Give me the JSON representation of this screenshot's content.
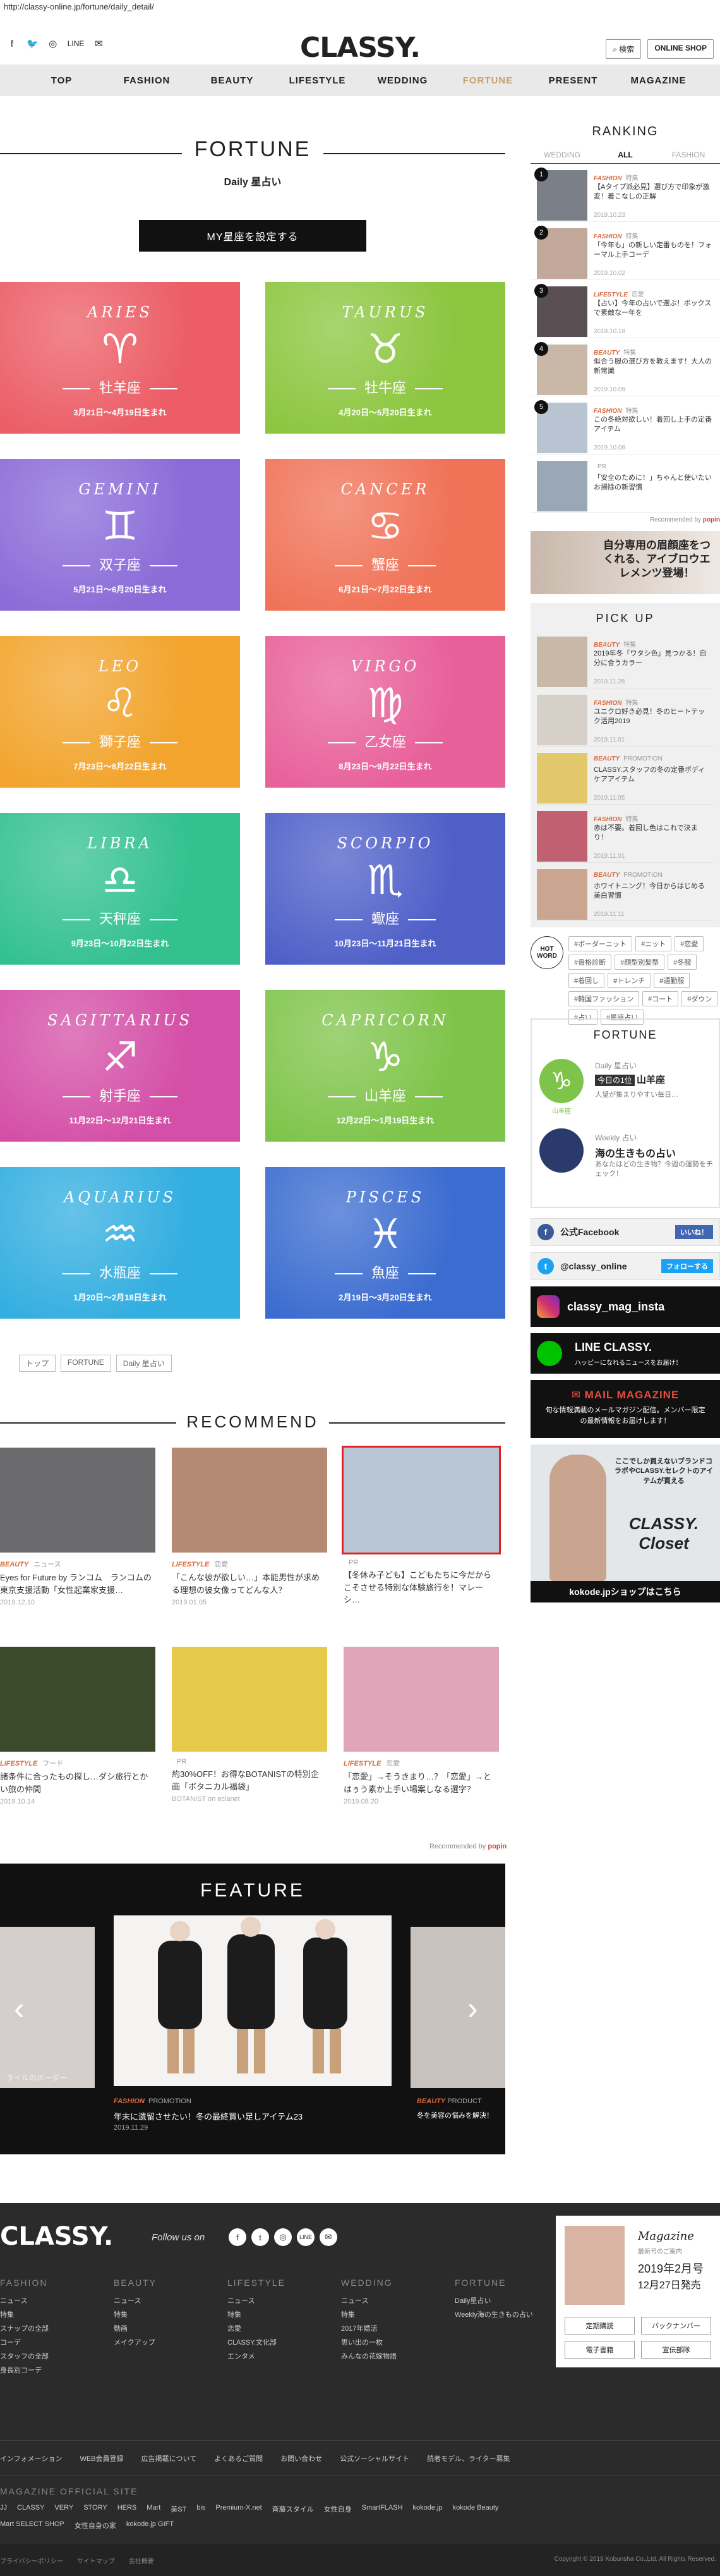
{
  "url": "http://classy-online.jp/fortune/daily_detail/",
  "header": {
    "logo": "CLASSY.",
    "social": [
      "f",
      "🐦",
      "◎",
      "LINE",
      "✉"
    ],
    "btn_search": "検索",
    "btn_shop": "ONLINE SHOP"
  },
  "nav": [
    "TOP",
    "FASHION",
    "BEAUTY",
    "LIFESTYLE",
    "WEDDING",
    "FORTUNE",
    "PRESENT",
    "MAGAZINE"
  ],
  "fortune": {
    "title": "FORTUNE",
    "subtitle": "Daily 星占い",
    "set_button": "MY星座を設定する",
    "signs": [
      {
        "en": "ARIES",
        "sym": "♈",
        "jp": "牡羊座",
        "date": "3月21日〜4月19日生まれ",
        "color": "#ec5d66"
      },
      {
        "en": "TAURUS",
        "sym": "♉",
        "jp": "牡牛座",
        "date": "4月20日〜5月20日生まれ",
        "color": "#8cc63f"
      },
      {
        "en": "GEMINI",
        "sym": "♊",
        "jp": "双子座",
        "date": "5月21日〜6月20日生まれ",
        "color": "#8a6bd8"
      },
      {
        "en": "CANCER",
        "sym": "♋",
        "jp": "蟹座",
        "date": "6月21日〜7月22日生まれ",
        "color": "#f07257"
      },
      {
        "en": "LEO",
        "sym": "♌",
        "jp": "獅子座",
        "date": "7月23日〜8月22日生まれ",
        "color": "#f2a42c"
      },
      {
        "en": "VIRGO",
        "sym": "♍",
        "jp": "乙女座",
        "date": "8月23日〜9月22日生まれ",
        "color": "#e8609a"
      },
      {
        "en": "LIBRA",
        "sym": "♎",
        "jp": "天秤座",
        "date": "9月23日〜10月22日生まれ",
        "color": "#33c190"
      },
      {
        "en": "SCORPIO",
        "sym": "♏",
        "jp": "蠍座",
        "date": "10月23日〜11月21日生まれ",
        "color": "#4e5fc8"
      },
      {
        "en": "SAGITTARIUS",
        "sym": "♐",
        "jp": "射手座",
        "date": "11月22日〜12月21日生まれ",
        "color": "#d44fa7"
      },
      {
        "en": "CAPRICORN",
        "sym": "♑",
        "jp": "山羊座",
        "date": "12月22日〜1月19日生まれ",
        "color": "#7fc44a"
      },
      {
        "en": "AQUARIUS",
        "sym": "♒",
        "jp": "水瓶座",
        "date": "1月20日〜2月18日生まれ",
        "color": "#33aee0"
      },
      {
        "en": "PISCES",
        "sym": "♓",
        "jp": "魚座",
        "date": "2月19日〜3月20日生まれ",
        "color": "#3b6cd0"
      }
    ]
  },
  "breadcrumb": [
    "トップ",
    "FORTUNE",
    "Daily 星占い"
  ],
  "recommend": {
    "title": "RECOMMEND",
    "powered": "Recommended by",
    "cards": [
      {
        "cat": "BEAUTY",
        "sub": "ニュース",
        "ttl": "Eyes for Future by ランコム　ランコムの東京支援活動「女性起業家支援…",
        "date": "2019.12.10",
        "color": "#6b6a6c"
      },
      {
        "cat": "LIFESTYLE",
        "sub": "恋愛",
        "ttl": "「こんな彼が欲しい…」本能男性が求める理想の彼女像ってどんな人？",
        "date": "2019.01.05",
        "color": "#b58a74"
      },
      {
        "cat": "",
        "sub": "PR",
        "ttl": "【冬休み子ども】こどもたちに今だからこそさせる特別な体験旅行を！マレーシ…",
        "date": "",
        "color": "#b9c6d6"
      },
      {
        "cat": "LIFESTYLE",
        "sub": "フード",
        "ttl": "諸条件に合ったもの探し…ダシ旅行とかい旅の仲間",
        "date": "2019.10.14",
        "color": "#3a4a2a"
      },
      {
        "cat": "",
        "sub": "PR",
        "ttl": "約30%OFF！お得なBOTANISTの特別企画「ボタニカル福袋」",
        "date": "BOTANIST on eclanet",
        "color": "#e7c94c"
      },
      {
        "cat": "LIFESTYLE",
        "sub": "恋愛",
        "ttl": "「恋愛」→そうきまり…？「恋愛」→とはぅう素か上手い場案しなる選字？",
        "date": "2019.08.20",
        "color": "#e0a5b8"
      }
    ]
  },
  "feature": {
    "title": "FEATURE",
    "cat": "FASHION",
    "sub": "PROMOTION",
    "ttl": "年末に遺留させたい！冬の最終買い足しアイテム23",
    "date": "2019.11.29",
    "left_txt": "タイルのボーダー",
    "right_cat": "BEAUTY",
    "right_sub": "PRODUCT",
    "right_txt": "冬を美容の悩みを解決！"
  },
  "ranking": {
    "title": "RANKING",
    "tabs": [
      "WEDDING",
      "ALL",
      "FASHION"
    ],
    "items": [
      {
        "n": "1",
        "cat": "FASHION",
        "sub": "特集",
        "ttl": "【Aタイプ派必見】選び方で印象が激変！着こなしの正解",
        "date": "2019.10.23",
        "color": "#7a7f88"
      },
      {
        "n": "2",
        "cat": "FASHION",
        "sub": "特集",
        "ttl": "「今年も」の新しい定番ものを！フォーマル上手コーデ",
        "date": "2019.10.02",
        "color": "#c2a89a"
      },
      {
        "n": "3",
        "cat": "LIFESTYLE",
        "sub": "恋愛",
        "ttl": "【占い】今年の占いで選ぶ！ボックスで素敵な一年を",
        "date": "2019.10.18",
        "color": "#5a4f52"
      },
      {
        "n": "4",
        "cat": "BEAUTY",
        "sub": "特集",
        "ttl": "似合う服の選び方を教えます！大人の新常識",
        "date": "2019.10.09",
        "color": "#c9b7a7"
      },
      {
        "n": "5",
        "cat": "FASHION",
        "sub": "特集",
        "ttl": "この冬絶対欲しい！着回し上手の定番アイテム",
        "date": "2019.10.08",
        "color": "#b8c4d2"
      },
      {
        "n": "",
        "cat": "",
        "sub": "PR",
        "ttl": "「安全のために！」ちゃんと使いたいお掃除の新習慣",
        "date": "",
        "color": "#9aa8b5"
      }
    ],
    "powered": "Recommended by"
  },
  "banner1": "自分専用の眉顔座をつくれる、アイブロウエレメンツ登場！",
  "pickup": {
    "title": "PICK UP",
    "items": [
      {
        "cat": "BEAUTY",
        "sub": "特集",
        "ttl": "2019年冬「ワタシ色」見つかる！自分に合うカラー",
        "date": "2019.11.28",
        "color": "#c8b8a8"
      },
      {
        "cat": "FASHION",
        "sub": "特集",
        "ttl": "ユニクロ好き必見！冬のヒートテック活用2019",
        "date": "2019.11.01",
        "color": "#d6d0c8"
      },
      {
        "cat": "BEAUTY",
        "sub": "PROMOTION",
        "ttl": "CLASSY.スタッフの冬の定番ボディケアアイテム",
        "date": "2019.11.05",
        "color": "#e2c86a"
      },
      {
        "cat": "FASHION",
        "sub": "特集",
        "ttl": "赤は不要。着回し色はこれで決まり！",
        "date": "2019.11.01",
        "color": "#c06070"
      },
      {
        "cat": "BEAUTY",
        "sub": "PROMOTION",
        "ttl": "ホワイトニング！今日からはじめる美白習慣",
        "date": "2019.11.11",
        "color": "#caa690"
      }
    ]
  },
  "hotword": {
    "label": "HOT WORD",
    "tags": [
      "#ボーダーニット",
      "#ニット",
      "#恋愛",
      "#骨格診断",
      "#顔型別髪型",
      "#冬服",
      "#着回し",
      "#トレンチ",
      "#通勤服",
      "#韓国ファッション",
      "#コート",
      "#ダウン",
      "#占い",
      "#星座占い"
    ]
  },
  "fortune_box": {
    "title": "FORTUNE",
    "daily_label": "Daily 星占い",
    "today_label": "今日の1位",
    "today_sign": "山羊座",
    "daily_txt": "人望が集まりやすい毎日…",
    "sign_badge": "山羊座",
    "weekly_label": "Weekly 占い",
    "weekly_ttl": "海の生きもの占い",
    "weekly_txt": "あなたはどの生き物？今週の運勢をチェック！"
  },
  "sns": {
    "fb": "公式Facebook",
    "fb_like": "いいね！",
    "tw": "@classy_online",
    "tw_follow": "フォローする",
    "ig": "classy_mag_insta",
    "line": "LINE CLASSY.",
    "line_sub": "ハッピーになれるニュースをお届け！",
    "mail": "MAIL MAGAZINE",
    "mail_sub": "旬な情報満載のメールマガジン配信。メンバー限定の最新情報をお届けします！",
    "closet": "CLASSY. Closet",
    "closet_sub": "ここでしか買えないブランドコラボやCLASSY.セレクトのアイテムが買える",
    "shop": "kokode.jpショップはこちら"
  },
  "footer": {
    "logo": "CLASSY.",
    "follow": "Follow us on",
    "cols": [
      {
        "h": "FASHION",
        "items": [
          "ニュース",
          "特集",
          "スナップの全部",
          "コーデ",
          "スタッフの全部",
          "身長別コーデ"
        ]
      },
      {
        "h": "BEAUTY",
        "items": [
          "ニュース",
          "特集",
          "動画",
          "メイクアップ"
        ]
      },
      {
        "h": "LIFESTYLE",
        "items": [
          "ニュース",
          "特集",
          "恋愛",
          "CLASSY.文化部",
          "エンタメ"
        ]
      },
      {
        "h": "WEDDING",
        "items": [
          "ニュース",
          "特集",
          "2017年婚活",
          "思い出の一枚",
          "みんなの花嫁物語"
        ]
      },
      {
        "h": "FORTUNE",
        "items": [
          "Daily星占い",
          "Weekly海の生きもの占い"
        ]
      }
    ],
    "magazine": {
      "title": "Magazine",
      "sub": "最新号のご案内",
      "issue": "2019年2月号",
      "date": "12月27日発売",
      "btns": [
        "定期購読",
        "バックナンバー",
        "電子書籍",
        "宣伝部隊"
      ]
    },
    "links": [
      "インフォメーション",
      "WEB会員登録",
      "広告掲載について",
      "よくあるご質問",
      "お問い合わせ",
      "公式ソーシャルサイト",
      "読者モデル、ライター募集"
    ],
    "site_h": "MAGAZINE OFFICIAL SITE",
    "sites": [
      "JJ",
      "CLASSY",
      "VERY",
      "STORY",
      "HERS",
      "Mart",
      "美ST",
      "bis",
      "Premium-X.net",
      "斉藤スタイル",
      "女性自身",
      "SmartFLASH",
      "kokode.jp",
      "kokode Beauty",
      "Mart SELECT SHOP",
      "女性自身の家",
      "kokode.jp GIFT"
    ],
    "bottom": [
      "プライバシーポリシー",
      "サイトマップ",
      "会社概要"
    ],
    "copy": "Copyright © 2019 Kobunsha Co.,Ltd. All Rights Reserved."
  }
}
